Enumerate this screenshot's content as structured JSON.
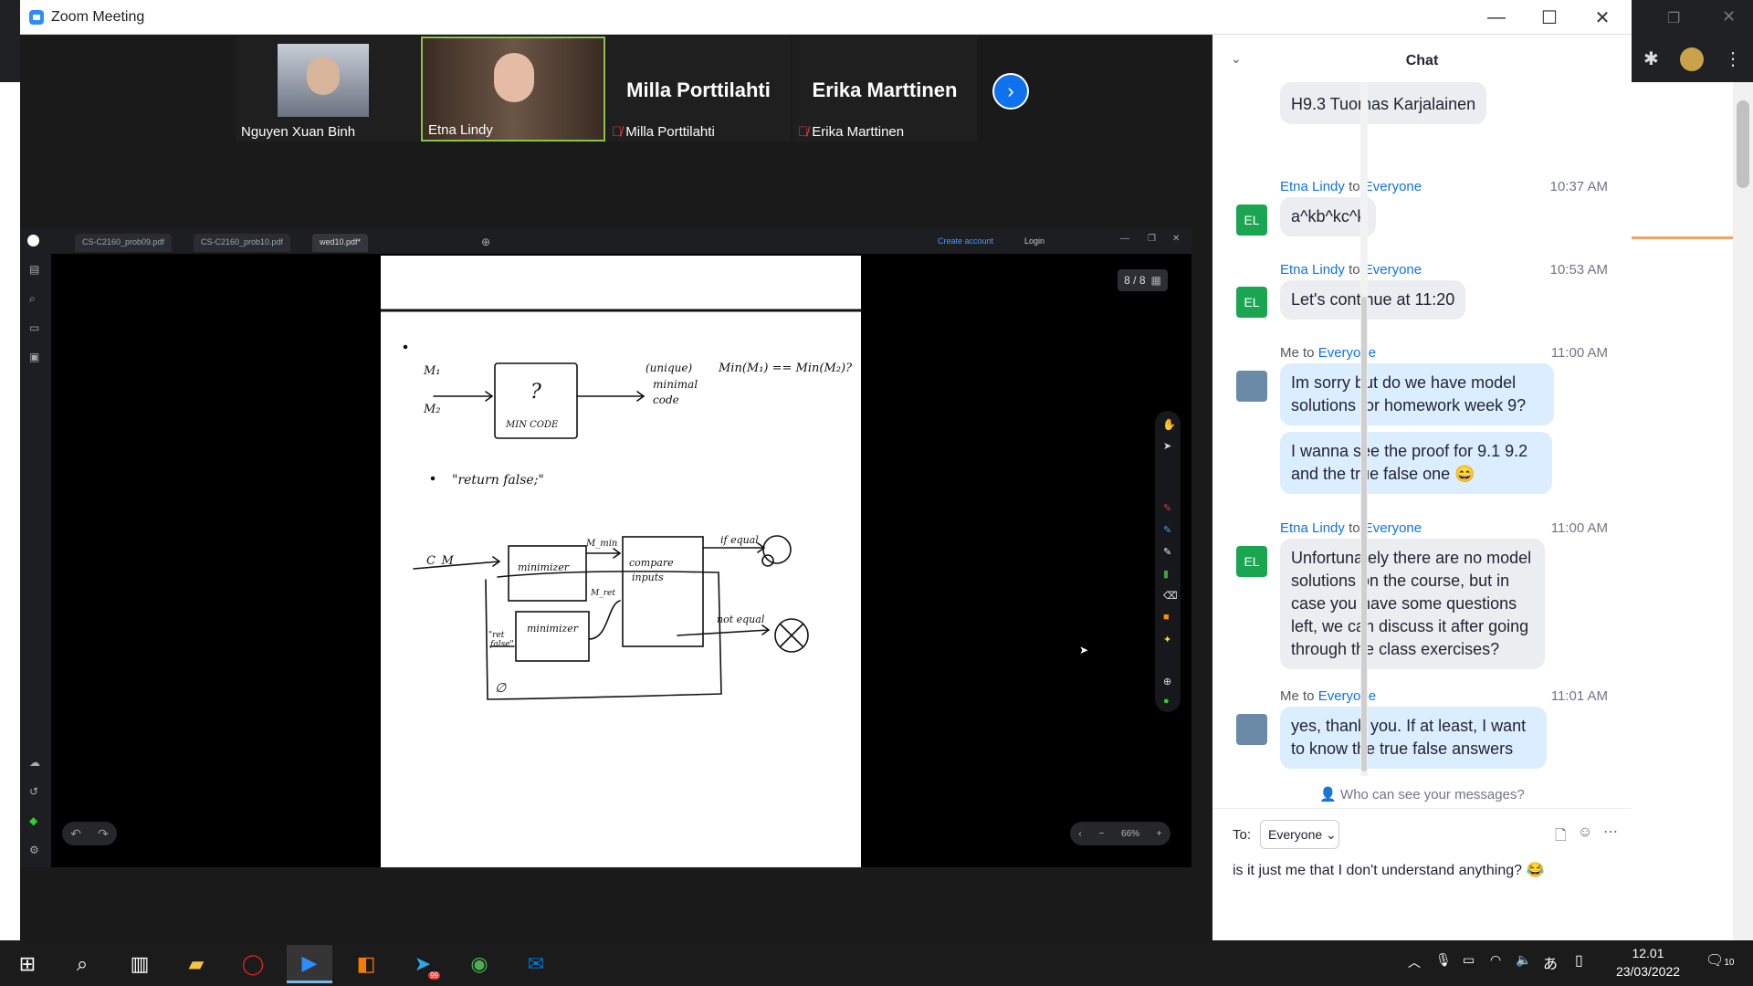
{
  "window": {
    "title": "Zoom Meeting"
  },
  "gallery": {
    "tiles": [
      {
        "name": "Nguyen Xuan Binh",
        "type": "video"
      },
      {
        "name": "Etna Lindy",
        "type": "video"
      },
      {
        "name": "Milla Porttilahti",
        "type": "name"
      },
      {
        "name": "Erika Marttinen",
        "type": "name"
      }
    ]
  },
  "share": {
    "tabs": [
      "CS-C2160_prob09.pdf",
      "CS-C2160_prob10.pdf",
      "wed10.pdf*"
    ],
    "create_account": "Create account",
    "login": "Login",
    "page_indicator": "8 / 8",
    "zoom": "66%"
  },
  "chat": {
    "title": "Chat",
    "partial": "H9.3 Tuomas Karjalainen",
    "messages": [
      {
        "sender": "Etna Lindy",
        "to": "to",
        "target": "Everyone",
        "time": "10:37 AM",
        "initials": "EL",
        "lines": [
          "a^kb^kc^k"
        ]
      },
      {
        "sender": "Etna Lindy",
        "to": "to",
        "target": "Everyone",
        "time": "10:53 AM",
        "initials": "EL",
        "lines": [
          "Let's continue at 11:20"
        ]
      },
      {
        "sender": "Me",
        "to": "to",
        "target": "Everyone",
        "time": "11:00 AM",
        "initials": "",
        "lines": [
          "Im sorry but do we have model solutions for homework week 9?",
          "I wanna see the proof for 9.1 9.2 and the true false one 😄"
        ]
      },
      {
        "sender": "Etna Lindy",
        "to": "to",
        "target": "Everyone",
        "time": "11:00 AM",
        "initials": "EL",
        "lines": [
          "Unfortunately there are no model solutions on the course, but in case you have some questions left, we can discuss it after going through the class exercises?"
        ]
      },
      {
        "sender": "Me",
        "to": "to",
        "target": "Everyone",
        "time": "11:01 AM",
        "initials": "",
        "lines": [
          "yes, thank you. If at least, I want to know the true false answers"
        ]
      }
    ],
    "who_can_see": "Who can see your messages?",
    "to_label": "To:",
    "to_value": "Everyone",
    "input_text": "is it just me that I don't understand anything? 😂"
  },
  "taskbar": {
    "time": "12.01",
    "date": "23/03/2022",
    "notifications": "10",
    "telegram_badge": "99"
  }
}
